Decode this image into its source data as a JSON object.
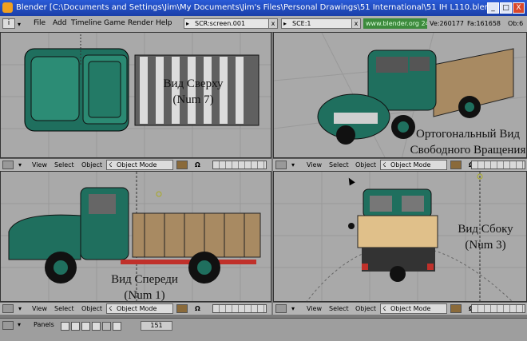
{
  "window": {
    "title": "Blender [C:\\Documents and Settings\\Jim\\My Documents\\Jim's Files\\Personal Drawings\\51 International\\51 IH L110.blend]",
    "minimize": "_",
    "maximize": "□",
    "close": "X"
  },
  "menubar": {
    "items": [
      "File",
      "Add",
      "Timeline",
      "Game",
      "Render",
      "Help"
    ],
    "screen_field": "SCR:screen.001",
    "scene_field": "SCE:1",
    "website": "www.blender.org 242",
    "stats": [
      "Ve:260177",
      "Fa:161658",
      "Ob:6"
    ]
  },
  "viewports": [
    {
      "label": "Вид Сверху\n(Num 7)"
    },
    {
      "label": "Ортогональный Вид\nСвободного Вращения"
    },
    {
      "label": "Вид Спереди\n(Num 1)"
    },
    {
      "label": "Вид Сбоку\n(Num 3)"
    }
  ],
  "viewport_header": {
    "view": "View",
    "select": "Select",
    "object": "Object",
    "mode": "Object Mode"
  },
  "bottom": {
    "panels": "Panels",
    "frame": "151"
  },
  "colors": {
    "truck_green": "#1f6f5e",
    "bed_wood": "#a88a62",
    "viewport_bg": "#a9a9a9"
  }
}
